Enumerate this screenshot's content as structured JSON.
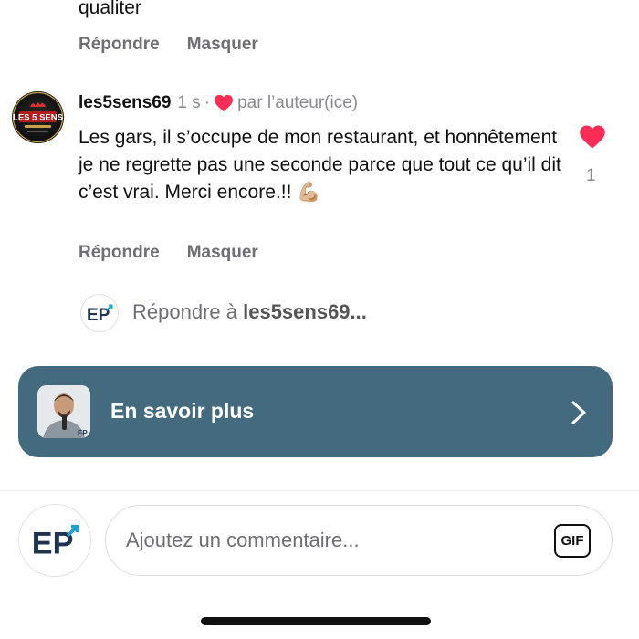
{
  "previous_comment": {
    "text_tail": "qualiter",
    "reply_label": "Répondre",
    "hide_label": "Masquer"
  },
  "comment": {
    "username": "les5sens69",
    "time": "1 s",
    "separator": "·",
    "liked_by_author": "par l’auteur(ice)",
    "text": "Les gars, il s’occupe de mon restaurant, et honnêtement je ne regrette pas une seconde parce que tout ce qu’il dit c’est vrai. Merci encore.!! 💪🏼",
    "like_count": "1",
    "reply_label": "Répondre",
    "hide_label": "Masquer",
    "avatar_text": "LES 5 SENS"
  },
  "reply_prompt": {
    "prefix": "Répondre à",
    "target": "les5sens69..."
  },
  "banner": {
    "label": "En savoir plus",
    "color": "#436a7e"
  },
  "composer": {
    "placeholder": "Ajoutez un commentaire...",
    "gif_label": "GIF",
    "avatar_text": "EP"
  },
  "colors": {
    "heart": "#ff2d55",
    "secondary_text": "#6e6e73",
    "brand_dark": "#1e3350",
    "brand_light": "#1aa3d9"
  }
}
